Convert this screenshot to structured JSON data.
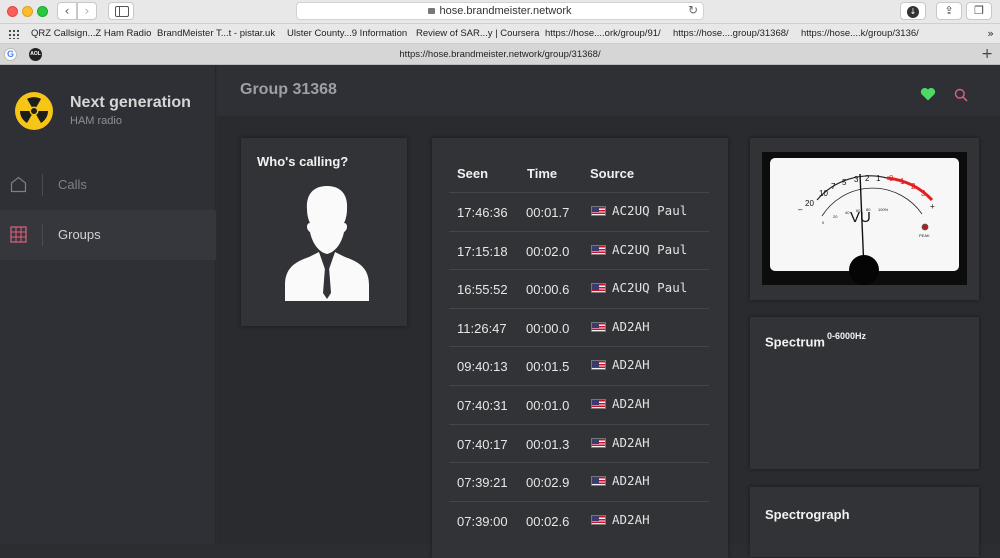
{
  "browser": {
    "address": "hose.brandmeister.network",
    "tab_url": "https://hose.brandmeister.network/group/31368/",
    "tab_icons": [
      "G",
      "AOL"
    ],
    "bookmarks": [
      "QRZ Callsign...Z Ham Radio",
      "BrandMeister T...t - pistar.uk",
      "Ulster County...9 Information",
      "Review of SAR...y | Coursera",
      "https://hose....ork/group/91/",
      "https://hose....group/31368/",
      "https://hose....k/group/3136/"
    ],
    "bookmarks_more": "»",
    "new_tab": "+"
  },
  "app": {
    "brand_title": "Next generation",
    "brand_subtitle": "HAM radio",
    "nav": [
      {
        "label": "Calls",
        "icon": "home-icon"
      },
      {
        "label": "Groups",
        "icon": "grid-icon"
      }
    ],
    "page_title": "Group 31368"
  },
  "who_calling": {
    "title": "Who's calling?"
  },
  "calls_table": {
    "headers": {
      "seen": "Seen",
      "time": "Time",
      "source": "Source"
    },
    "rows": [
      {
        "seen": "17:46:36",
        "time": "00:01.7",
        "source": "AC2UQ Paul"
      },
      {
        "seen": "17:15:18",
        "time": "00:02.0",
        "source": "AC2UQ Paul"
      },
      {
        "seen": "16:55:52",
        "time": "00:00.6",
        "source": "AC2UQ Paul"
      },
      {
        "seen": "11:26:47",
        "time": "00:00.0",
        "source": "AD2AH"
      },
      {
        "seen": "09:40:13",
        "time": "00:01.5",
        "source": "AD2AH"
      },
      {
        "seen": "07:40:31",
        "time": "00:01.0",
        "source": "AD2AH"
      },
      {
        "seen": "07:40:17",
        "time": "00:01.3",
        "source": "AD2AH"
      },
      {
        "seen": "07:39:21",
        "time": "00:02.9",
        "source": "AD2AH"
      },
      {
        "seen": "07:39:00",
        "time": "00:02.6",
        "source": "AD2AH"
      }
    ]
  },
  "vu_meter": {
    "label": "VU",
    "peak_label": "PEAK",
    "scale": [
      "20",
      "10",
      "7",
      "5",
      "3",
      "2",
      "1",
      "0",
      "1",
      "2",
      "3"
    ],
    "sub_scale": [
      "0",
      "20",
      "40",
      "60",
      "80",
      "100%"
    ],
    "minus": "–",
    "plus": "+"
  },
  "spectrum": {
    "title": "Spectrum",
    "range": "0-6000Hz"
  },
  "spectrograph": {
    "title": "Spectrograph"
  },
  "colors": {
    "accent_heart": "#4cd964",
    "search": "#e0607e",
    "logo": "#f5c518",
    "vu_red": "#e02020"
  }
}
